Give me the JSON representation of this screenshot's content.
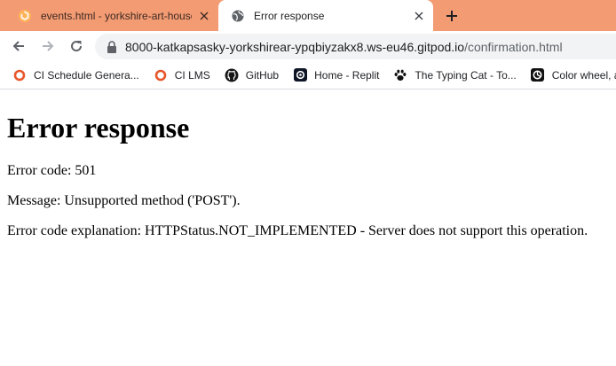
{
  "tabs": [
    {
      "title": "events.html - yorkshire-art-house",
      "icon": "gitpod-icon",
      "active": false
    },
    {
      "title": "Error response",
      "icon": "globe-icon",
      "active": true
    }
  ],
  "toolbar": {
    "url_host": "8000-katkapsasky-yorkshirear-ypqbiyzakx8.ws-eu46.gitpod.io",
    "url_path": "/confirmation.html"
  },
  "bookmarks": [
    {
      "label": "CI Schedule Genera...",
      "icon": "ci-icon"
    },
    {
      "label": "CI LMS",
      "icon": "ci-icon"
    },
    {
      "label": "GitHub",
      "icon": "github-icon"
    },
    {
      "label": "Home - Replit",
      "icon": "replit-icon"
    },
    {
      "label": "The Typing Cat - To...",
      "icon": "paw-icon"
    },
    {
      "label": "Color wheel, a co",
      "icon": "color-wheel-icon"
    }
  ],
  "page": {
    "heading": "Error response",
    "error_code": "Error code: 501",
    "message": "Message: Unsupported method ('POST').",
    "explanation": "Error code explanation: HTTPStatus.NOT_IMPLEMENTED - Server does not support this operation."
  },
  "colors": {
    "tabstrip": "#f39b73",
    "ci_orange": "#e8562a",
    "omnibox": "#f1f3f4"
  }
}
